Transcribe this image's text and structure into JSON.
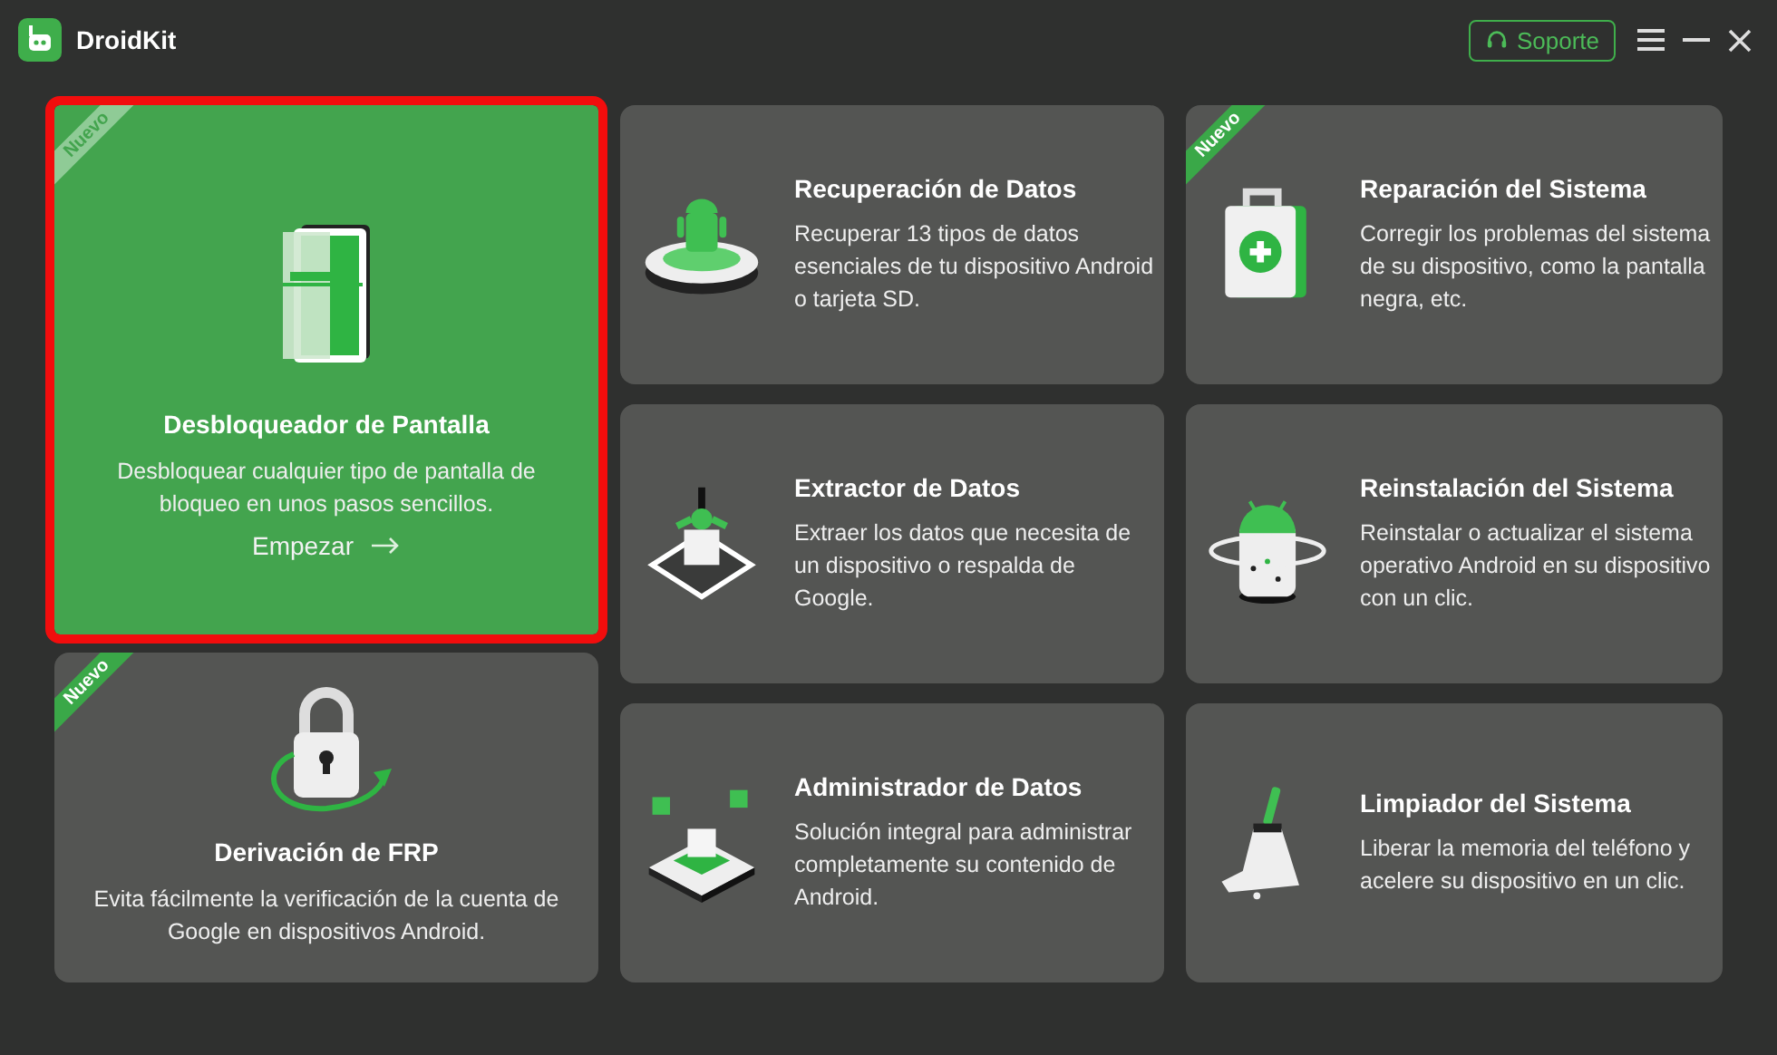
{
  "app": {
    "name": "DroidKit"
  },
  "header": {
    "support_button": "Soporte"
  },
  "columns": [
    {
      "cards": [
        {
          "kind": "featured",
          "title": "Desbloqueador de Pantalla",
          "description": "Desbloquear cualquier tipo de pantalla de bloqueo en unos pasos sencillos.",
          "badge": "Nuevo",
          "action": "Empezar",
          "selected": true,
          "outlined": true
        },
        {
          "kind": "compact",
          "title": "Derivación de FRP",
          "description": "Evita fácilmente la verificación de la cuenta de Google en dispositivos Android.",
          "badge": "Nuevo",
          "selected": false,
          "outlined": false
        }
      ]
    },
    {
      "cards": [
        {
          "kind": "tile",
          "title": "Recuperación de Datos",
          "description": "Recuperar 13 tipos de datos esenciales de tu dispositivo Android o tarjeta SD.",
          "selected": false,
          "outlined": false
        },
        {
          "kind": "tile",
          "title": "Extractor de Datos",
          "description": "Extraer los datos que necesita de un dispositivo o respalda de Google.",
          "selected": false,
          "outlined": false
        },
        {
          "kind": "tile",
          "title": "Administrador de Datos",
          "description": "Solución integral para administrar completamente su contenido de Android.",
          "selected": false,
          "outlined": false
        }
      ]
    },
    {
      "cards": [
        {
          "kind": "tile",
          "title": "Reparación del Sistema",
          "description": "Corregir los problemas del sistema de su dispositivo, como la pantalla negra, etc.",
          "badge": "Nuevo",
          "selected": false,
          "outlined": false
        },
        {
          "kind": "tile",
          "title": "Reinstalación del Sistema",
          "description": "Reinstalar o actualizar el sistema operativo Android en su dispositivo con un clic.",
          "selected": false,
          "outlined": false
        },
        {
          "kind": "tile",
          "title": "Limpiador del Sistema",
          "description": "Liberar la memoria del teléfono y acelere su dispositivo en un clic.",
          "selected": false,
          "outlined": false
        }
      ]
    }
  ]
}
